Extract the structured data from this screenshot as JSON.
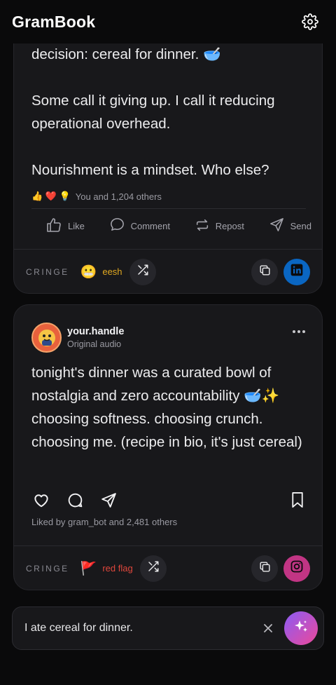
{
  "app": {
    "title": "GramBook"
  },
  "icons": {
    "settings": "gear-icon",
    "like": "thumbs-up-icon",
    "comment": "comment-bubble-icon",
    "repost": "repost-icon",
    "send": "paper-plane-icon",
    "shuffle": "shuffle-icon",
    "copy": "copy-icon",
    "linkedin": "linkedin-icon",
    "instagram": "instagram-icon",
    "heart": "heart-icon",
    "bookmark": "bookmark-icon",
    "more": "more-dots-icon",
    "clear": "close-icon",
    "generate": "sparkles-icon"
  },
  "linkedin_post": {
    "text_lines": [
      "decision: cereal for dinner. 🥣",
      "Some call it giving up. I call it reducing operational overhead.",
      "Nourishment is a mindset. Who else?"
    ],
    "reactions": {
      "emojis": "👍 ❤️ 💡",
      "text": "You and 1,204 others"
    },
    "actions": {
      "like": "Like",
      "comment": "Comment",
      "repost": "Repost",
      "send": "Send"
    },
    "footer": {
      "cringe_label": "CRINGE",
      "verdict_emoji": "😬",
      "verdict": "eesh",
      "verdict_color": "#e0a820"
    }
  },
  "instagram_post": {
    "handle": "your.handle",
    "subtitle": "Original audio",
    "caption": "tonight's dinner was a curated bowl of nostalgia and zero accountability 🥣✨ choosing softness. choosing crunch. choosing me. (recipe in bio, it's just cereal)",
    "liked_by": "Liked by gram_bot and 2,481 others",
    "footer": {
      "cringe_label": "CRINGE",
      "verdict_emoji": "🚩",
      "verdict": "red flag",
      "verdict_color": "#e0473c"
    }
  },
  "composer": {
    "value": "I ate cereal for dinner."
  },
  "colors": {
    "background": "#0a0a0b",
    "card": "#18181b",
    "linkedin_blue": "#0a66c2",
    "instagram_pink": "#c13584"
  }
}
